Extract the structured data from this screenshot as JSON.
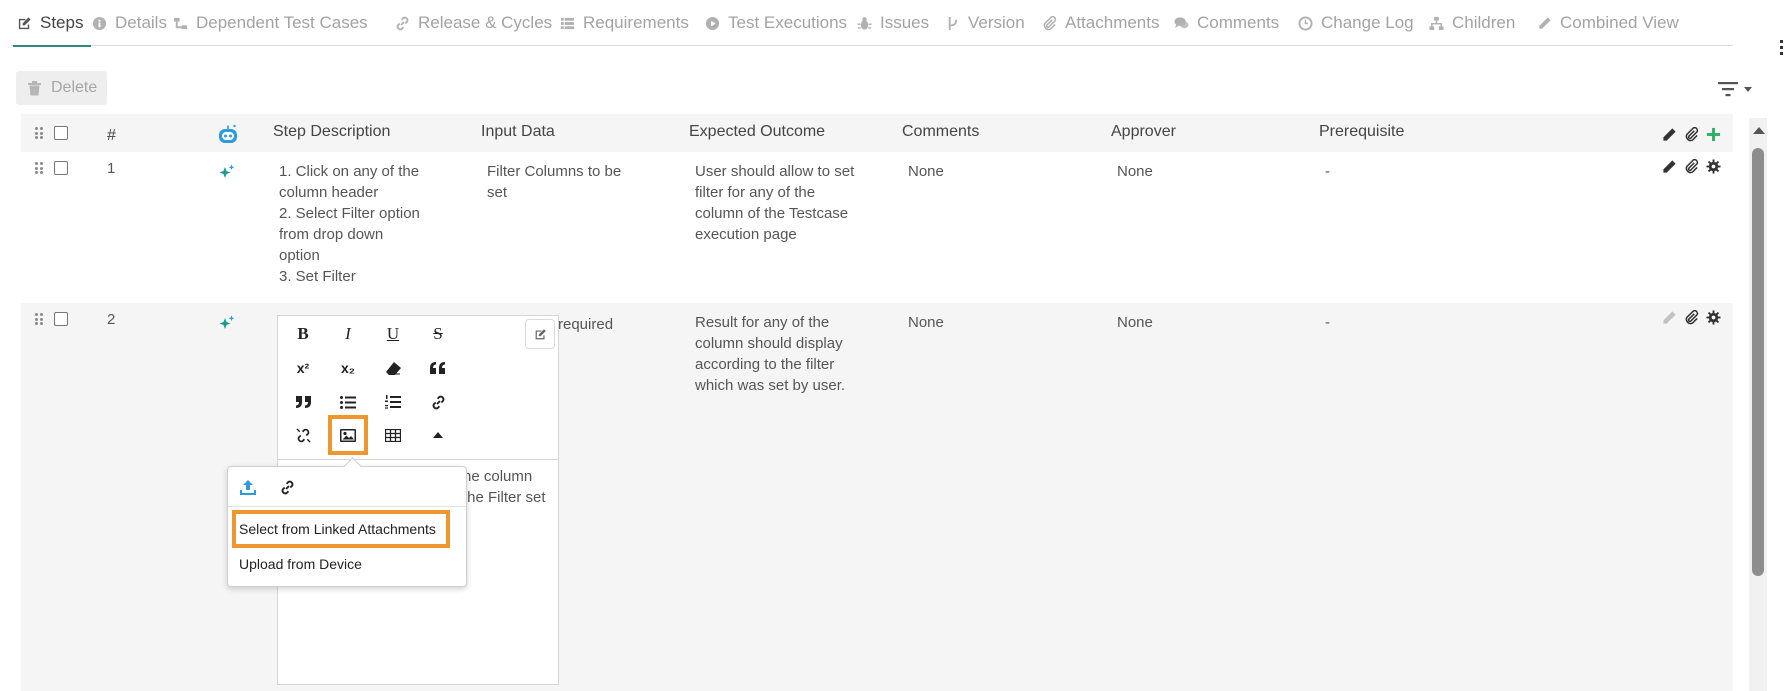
{
  "tabs": [
    {
      "label": "Steps",
      "icon": "edit-icon",
      "active": true
    },
    {
      "label": "Details",
      "icon": "info-icon"
    },
    {
      "label": "Dependent Test Cases",
      "icon": "sitemap-icon"
    },
    {
      "label": "Release & Cycles",
      "icon": "link-icon"
    },
    {
      "label": "Requirements",
      "icon": "list-icon"
    },
    {
      "label": "Test Executions",
      "icon": "play-circle-icon"
    },
    {
      "label": "Issues",
      "icon": "bug-icon"
    },
    {
      "label": "Version",
      "icon": "branch-icon"
    },
    {
      "label": "Attachments",
      "icon": "paperclip-icon"
    },
    {
      "label": "Comments",
      "icon": "comments-icon"
    },
    {
      "label": "Change Log",
      "icon": "clock-icon"
    },
    {
      "label": "Children",
      "icon": "hierarchy-icon"
    },
    {
      "label": "Combined View",
      "icon": "pencil-icon"
    }
  ],
  "toolbar": {
    "delete_label": "Delete"
  },
  "table": {
    "columns": {
      "number": "#",
      "step_description": "Step Description",
      "input_data": "Input Data",
      "expected_outcome": "Expected Outcome",
      "comments": "Comments",
      "approver": "Approver",
      "prerequisite": "Prerequisite"
    },
    "rows": [
      {
        "number": "1",
        "step_description": "1. Click on any of the\ncolumn header\n2. Select Filter option\nfrom drop down\noption\n3. Set Filter",
        "input_data": "Filter Columns to be\nset",
        "expected_outcome": "User should allow to set\nfilter for any of the\ncolumn of the Testcase\nexecution page",
        "comments": "None",
        "approver": "None",
        "prerequisite": "-"
      },
      {
        "number": "2",
        "input_data_partial": "required",
        "expected_outcome": "Result for any of the\ncolumn should display\naccording to the filter\nwhich was set by user.",
        "comments": "None",
        "approver": "None",
        "prerequisite": "-"
      }
    ]
  },
  "editor": {
    "toolbar_buttons": [
      {
        "label": "B",
        "icon": "bold-icon"
      },
      {
        "label": "I",
        "icon": "italic-icon"
      },
      {
        "label": "U",
        "icon": "underline-icon"
      },
      {
        "label": "S",
        "icon": "strikethrough-icon"
      },
      {
        "label": "x²",
        "icon": "superscript-icon"
      },
      {
        "label": "x₂",
        "icon": "subscript-icon"
      },
      {
        "icon": "eraser-icon"
      },
      {
        "icon": "quote-open-icon"
      },
      {
        "icon": "quote-close-icon"
      },
      {
        "icon": "bullet-list-icon"
      },
      {
        "icon": "numbered-list-icon"
      },
      {
        "icon": "link-icon"
      },
      {
        "icon": "unlink-icon"
      },
      {
        "icon": "image-icon",
        "highlighted": true
      },
      {
        "icon": "table-icon"
      },
      {
        "icon": "caret-up-icon"
      }
    ],
    "text_partial": "he column\nthe Filter set"
  },
  "image_popup": {
    "icons": [
      "upload-icon",
      "link-icon"
    ],
    "items": [
      {
        "label": "Select from Linked Attachments",
        "highlighted": true
      },
      {
        "label": "Upload from Device"
      }
    ]
  },
  "colors": {
    "active_tab_underline": "#2f8a7d",
    "highlight": "#f0962e",
    "add_green": "#27ae60",
    "bot_blue": "#2d9be0",
    "spark_teal": "#1a9c8c",
    "upload_blue": "#2d9be0"
  }
}
